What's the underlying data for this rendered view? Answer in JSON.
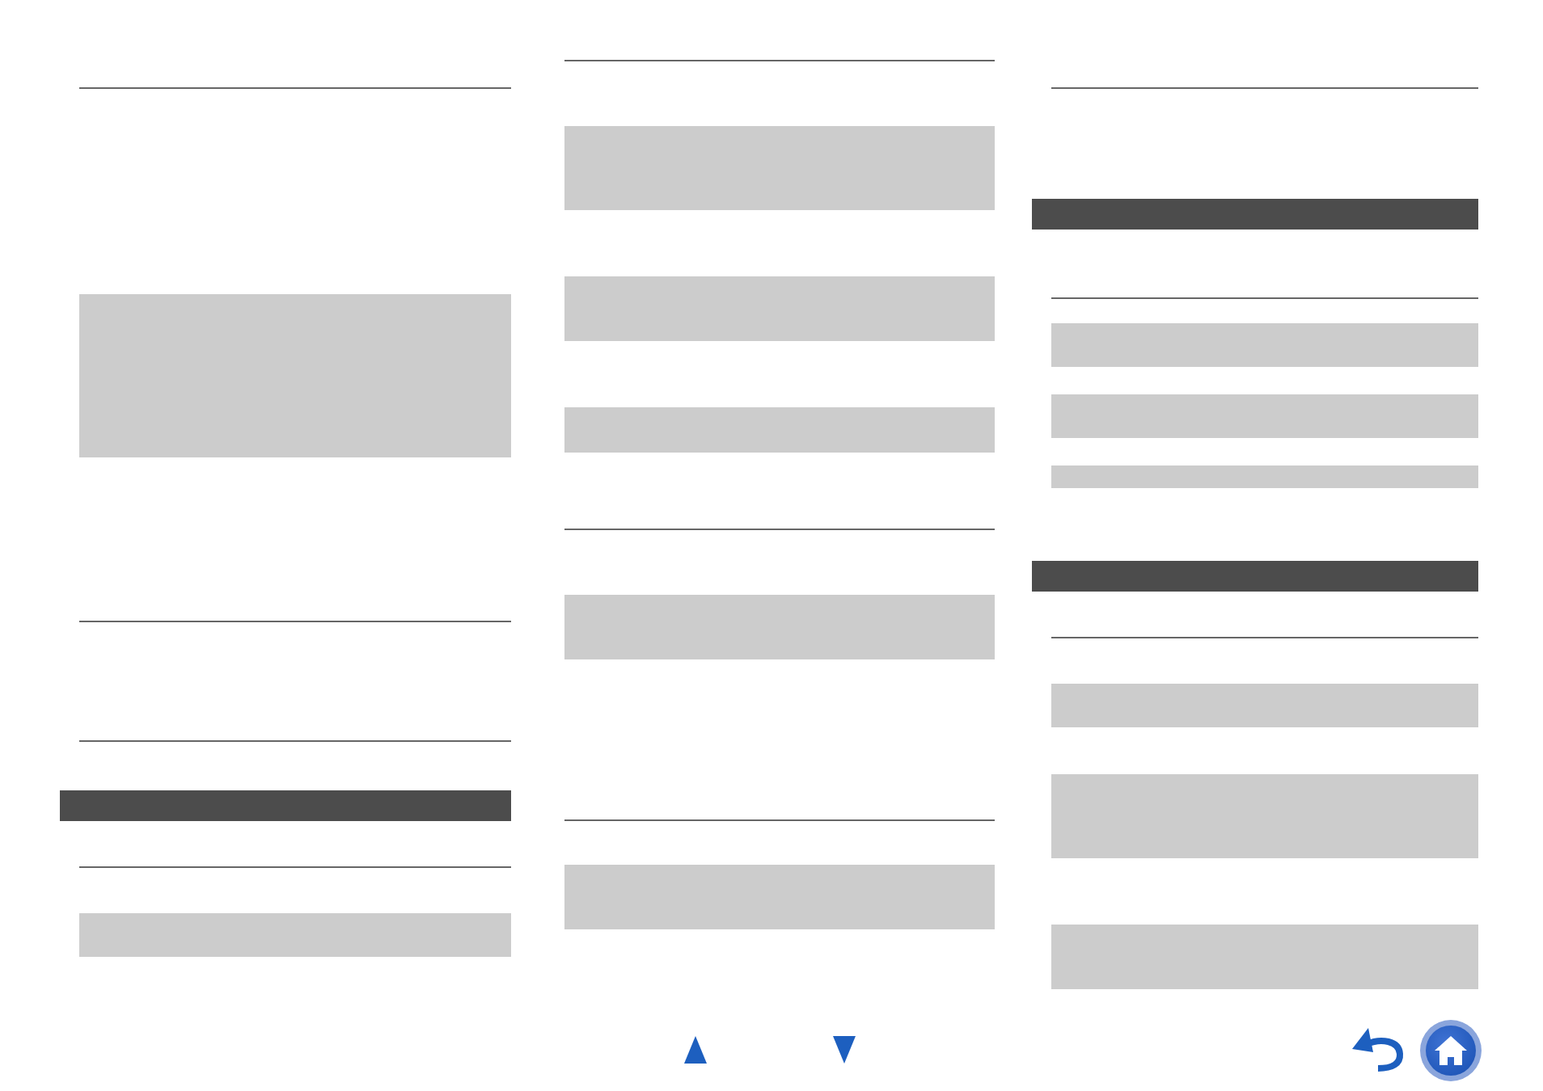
{
  "columns": [
    {
      "blocks": [
        {
          "kind": "rule"
        },
        {
          "kind": "shaded"
        },
        {
          "kind": "rule"
        },
        {
          "kind": "rule"
        },
        {
          "kind": "heading"
        },
        {
          "kind": "rule"
        },
        {
          "kind": "shaded"
        }
      ]
    },
    {
      "blocks": [
        {
          "kind": "rule"
        },
        {
          "kind": "shaded"
        },
        {
          "kind": "shaded"
        },
        {
          "kind": "shaded"
        },
        {
          "kind": "rule"
        },
        {
          "kind": "shaded"
        },
        {
          "kind": "rule"
        },
        {
          "kind": "shaded"
        }
      ]
    },
    {
      "blocks": [
        {
          "kind": "rule"
        },
        {
          "kind": "heading"
        },
        {
          "kind": "rule"
        },
        {
          "kind": "shaded"
        },
        {
          "kind": "shaded"
        },
        {
          "kind": "shaded"
        },
        {
          "kind": "heading"
        },
        {
          "kind": "rule"
        },
        {
          "kind": "shaded"
        },
        {
          "kind": "shaded"
        },
        {
          "kind": "shaded"
        }
      ]
    }
  ]
}
